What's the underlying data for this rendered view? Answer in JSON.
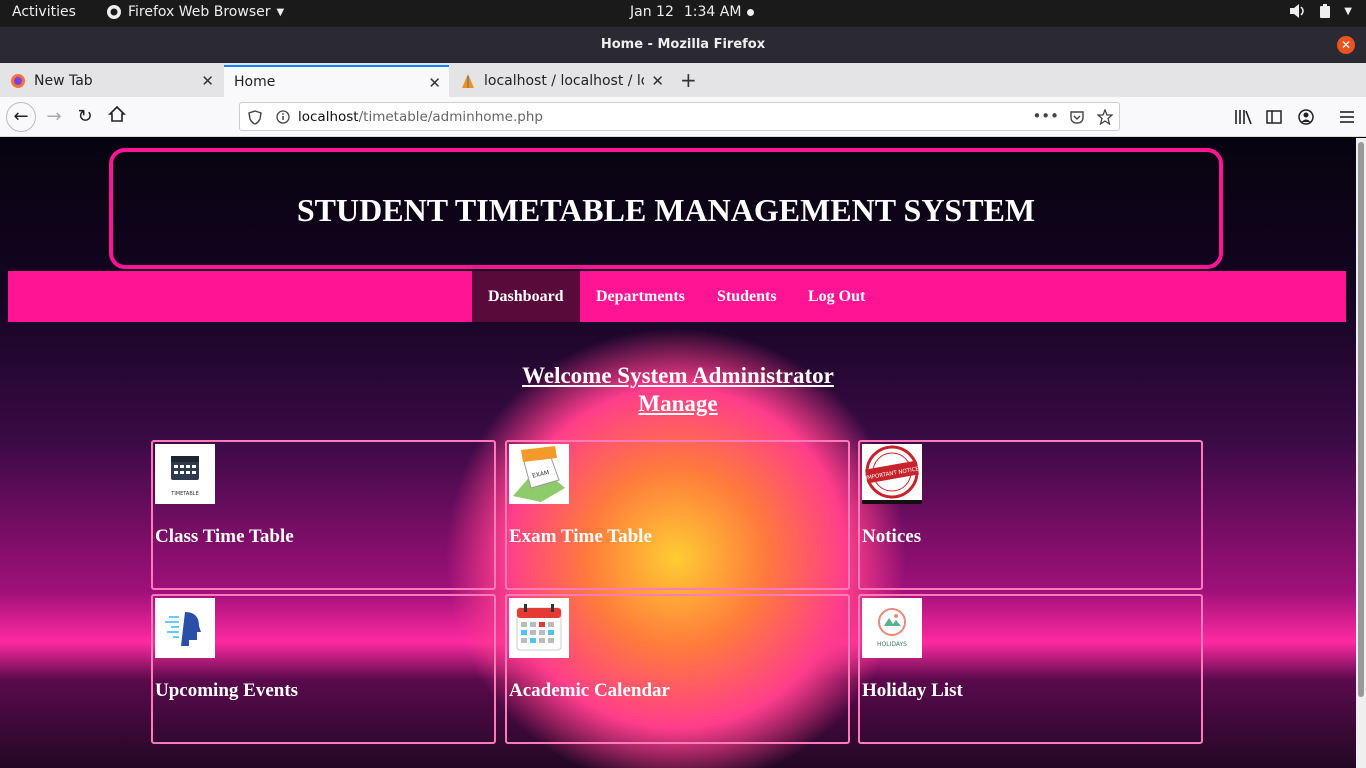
{
  "system": {
    "activities": "Activities",
    "app_name": "Firefox Web Browser",
    "date": "Jan 12",
    "time": "1:34 AM"
  },
  "window": {
    "title": "Home - Mozilla Firefox"
  },
  "tabs": [
    {
      "label": "New Tab"
    },
    {
      "label": "Home"
    },
    {
      "label": "localhost / localhost / logi"
    }
  ],
  "navbar": {
    "url_host": "localhost",
    "url_path": "/timetable/adminhome.php"
  },
  "page": {
    "header_title": "STUDENT TIMETABLE MANAGEMENT SYSTEM",
    "menu": [
      "Dashboard",
      "Departments",
      "Students",
      "Log Out"
    ],
    "active_menu": "Dashboard",
    "welcome_line1": "Welcome System Administrator",
    "welcome_line2": "Manage",
    "cards": [
      {
        "label": "Class Time Table",
        "icon": "timetable-icon",
        "icon_text": "TIMETABLE"
      },
      {
        "label": "Exam Time Table",
        "icon": "exam-icon",
        "icon_text": "EXAM"
      },
      {
        "label": "Notices",
        "icon": "important-notice-icon",
        "icon_text": "IMPORTANT NOTICE"
      },
      {
        "label": "Upcoming Events",
        "icon": "events-icon"
      },
      {
        "label": "Academic Calendar",
        "icon": "calendar-icon"
      },
      {
        "label": "Holiday List",
        "icon": "holidays-icon",
        "icon_text": "HOLIDAYS"
      }
    ]
  },
  "colors": {
    "accent": "#ff1493",
    "card_border": "#ff7ab8",
    "active_menu": "#5a0a3a"
  }
}
